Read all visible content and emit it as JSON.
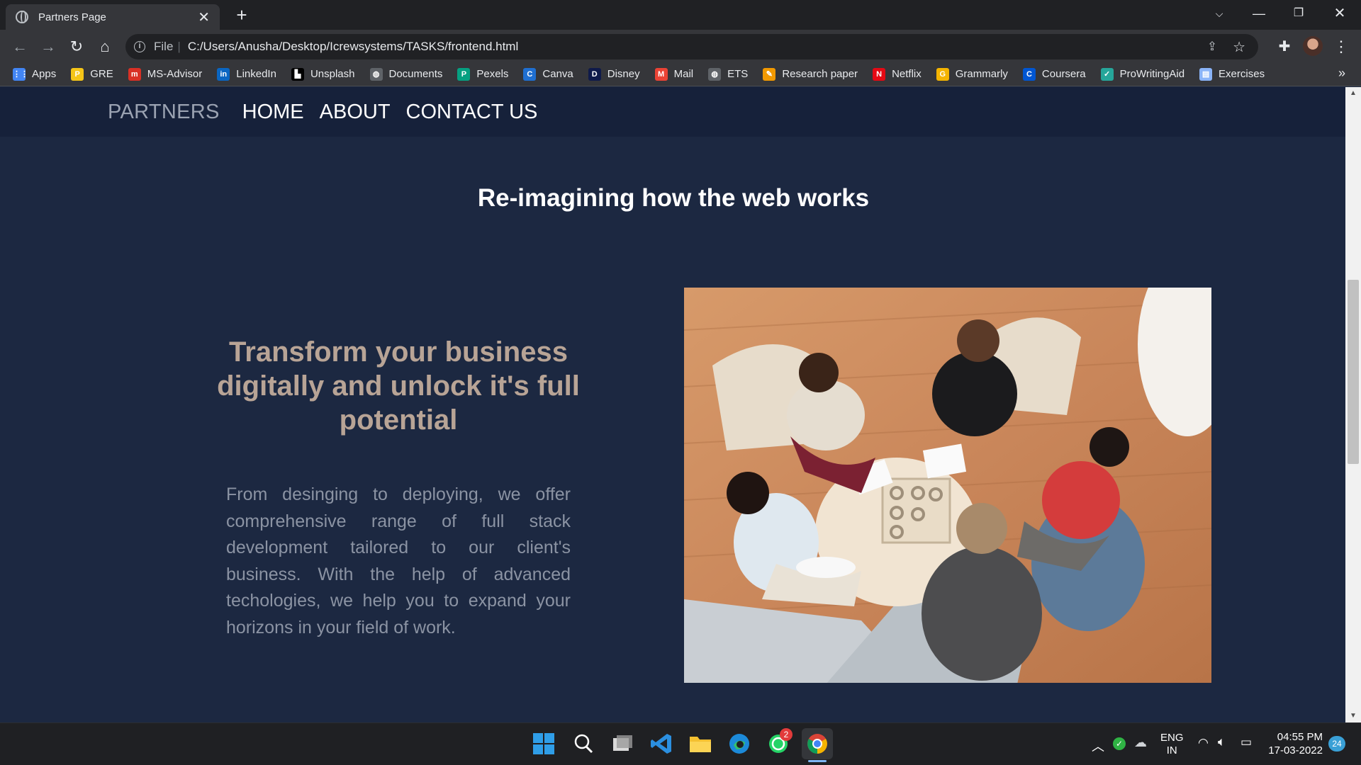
{
  "browser": {
    "tab_title": "Partners Page",
    "address_prefix": "File",
    "address_url": "C:/Users/Anusha/Desktop/Icrewsystems/TASKS/frontend.html",
    "more_bookmarks": "»",
    "bookmarks": [
      {
        "label": "Apps",
        "icon": "apps-grid-icon",
        "color": "#4285f4",
        "glyph": "⋮⋮"
      },
      {
        "label": "GRE",
        "icon": "gre-icon",
        "color": "#f5c518",
        "glyph": "P"
      },
      {
        "label": "MS-Advisor",
        "icon": "ms-advisor-icon",
        "color": "#d93025",
        "glyph": "m"
      },
      {
        "label": "LinkedIn",
        "icon": "linkedin-icon",
        "color": "#0a66c2",
        "glyph": "in"
      },
      {
        "label": "Unsplash",
        "icon": "unsplash-icon",
        "color": "#000000",
        "glyph": "▙"
      },
      {
        "label": "Documents",
        "icon": "globe-icon",
        "color": "#5f6368",
        "glyph": "◍"
      },
      {
        "label": "Pexels",
        "icon": "pexels-icon",
        "color": "#05a081",
        "glyph": "P"
      },
      {
        "label": "Canva",
        "icon": "canva-icon",
        "color": "#1f6fd1",
        "glyph": "C"
      },
      {
        "label": "Disney",
        "icon": "disney-icon",
        "color": "#0f1a4a",
        "glyph": "D"
      },
      {
        "label": "Mail",
        "icon": "gmail-icon",
        "color": "#ea4335",
        "glyph": "M"
      },
      {
        "label": "ETS",
        "icon": "globe-icon",
        "color": "#5f6368",
        "glyph": "◍"
      },
      {
        "label": "Research paper",
        "icon": "research-paper-icon",
        "color": "#f29900",
        "glyph": "✎"
      },
      {
        "label": "Netflix",
        "icon": "netflix-icon",
        "color": "#e50914",
        "glyph": "N"
      },
      {
        "label": "Grammarly",
        "icon": "grammarly-icon",
        "color": "#f4b400",
        "glyph": "G"
      },
      {
        "label": "Coursera",
        "icon": "coursera-icon",
        "color": "#0056d2",
        "glyph": "C"
      },
      {
        "label": "ProWritingAid",
        "icon": "prowritingaid-icon",
        "color": "#26a69a",
        "glyph": "✓"
      },
      {
        "label": "Exercises",
        "icon": "exercises-icon",
        "color": "#8ab4f8",
        "glyph": "▤"
      }
    ]
  },
  "site": {
    "nav": {
      "brand": "PARTNERS",
      "links": [
        "HOME",
        "ABOUT",
        "CONTACT US"
      ]
    },
    "headline": "Re-imagining how the web works",
    "tagline": "Transform your business digitally and unlock it's full potential",
    "paragraph": "From desinging to deploying, we offer comprehensive range of full stack development tailored to our client's business. With the help of advanced techologies, we help you to expand your horizons in your field of work."
  },
  "taskbar": {
    "whatsapp_badge": "2",
    "lang_line1": "ENG",
    "lang_line2": "IN",
    "time": "04:55 PM",
    "date": "17-03-2022",
    "notification_count": "24"
  },
  "colors": {
    "page_bg": "#1c2841",
    "nav_bg": "#16213a",
    "tagline": "#b8a496",
    "paragraph": "#8b93a3"
  }
}
